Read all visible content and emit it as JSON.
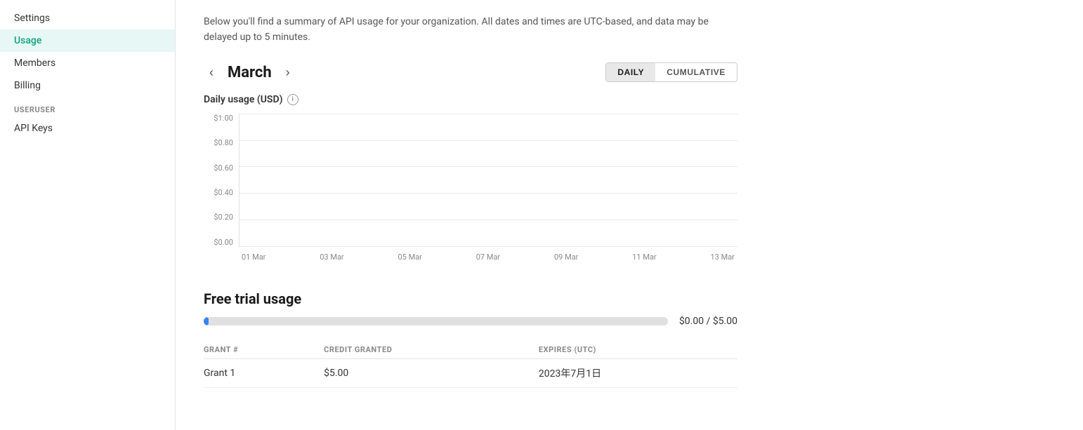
{
  "sidebar": {
    "org_section_label": "",
    "items": [
      {
        "id": "settings",
        "label": "Settings",
        "active": false
      },
      {
        "id": "usage",
        "label": "Usage",
        "active": true
      },
      {
        "id": "members",
        "label": "Members",
        "active": false
      },
      {
        "id": "billing",
        "label": "Billing",
        "active": false
      }
    ],
    "user_section_label": "USER",
    "user_items": [
      {
        "id": "api-keys",
        "label": "API Keys",
        "active": false
      }
    ]
  },
  "main": {
    "description": "Below you'll find a summary of API usage for your organization. All dates and times are UTC-based, and data may be delayed up to 5 minutes.",
    "month_nav": {
      "prev_arrow": "‹",
      "next_arrow": "›",
      "current_month": "March"
    },
    "view_toggle": {
      "daily_label": "DAILY",
      "cumulative_label": "CUMULATIVE",
      "active": "daily"
    },
    "chart": {
      "title": "Daily usage (USD)",
      "info_icon": "i",
      "y_labels": [
        "$1.00",
        "$0.80",
        "$0.60",
        "$0.40",
        "$0.20",
        "$0.00"
      ],
      "x_labels": [
        "01 Mar",
        "03 Mar",
        "05 Mar",
        "07 Mar",
        "09 Mar",
        "11 Mar",
        "13 Mar"
      ]
    },
    "free_trial": {
      "title": "Free trial usage",
      "progress_amount": "$0.00 / $5.00",
      "progress_percent": 1,
      "table": {
        "headers": [
          "GRANT #",
          "CREDIT GRANTED",
          "EXPIRES (UTC)"
        ],
        "rows": [
          {
            "grant": "Grant 1",
            "credit": "$5.00",
            "expires": "2023年7月1日"
          }
        ]
      }
    }
  }
}
